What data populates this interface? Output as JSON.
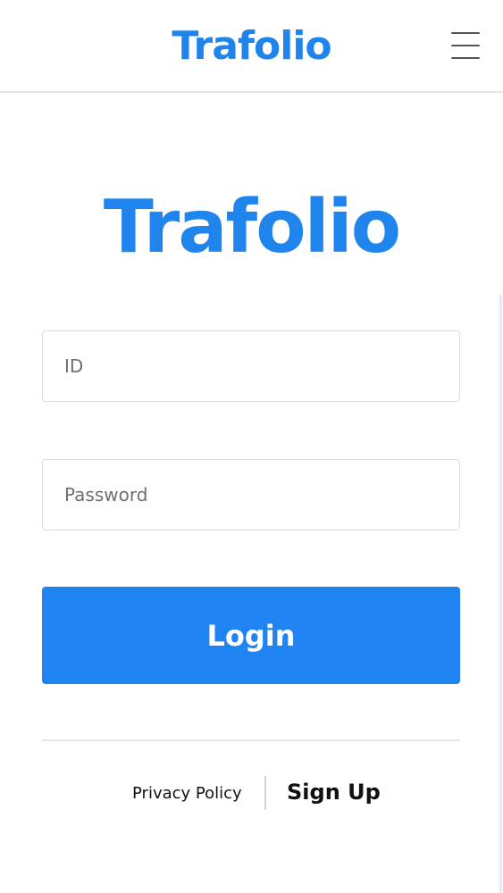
{
  "header": {
    "logo_text": "Trafolio",
    "menu_icon": "hamburger-menu-icon"
  },
  "hero": {
    "logo_text": "Trafolio"
  },
  "form": {
    "id_placeholder": "ID",
    "password_placeholder": "Password",
    "login_label": "Login"
  },
  "footer": {
    "privacy_label": "Privacy Policy",
    "signup_label": "Sign Up"
  },
  "colors": {
    "brand": "#1f84ec",
    "button": "#1f84f2",
    "divider": "#e4e4e6"
  }
}
